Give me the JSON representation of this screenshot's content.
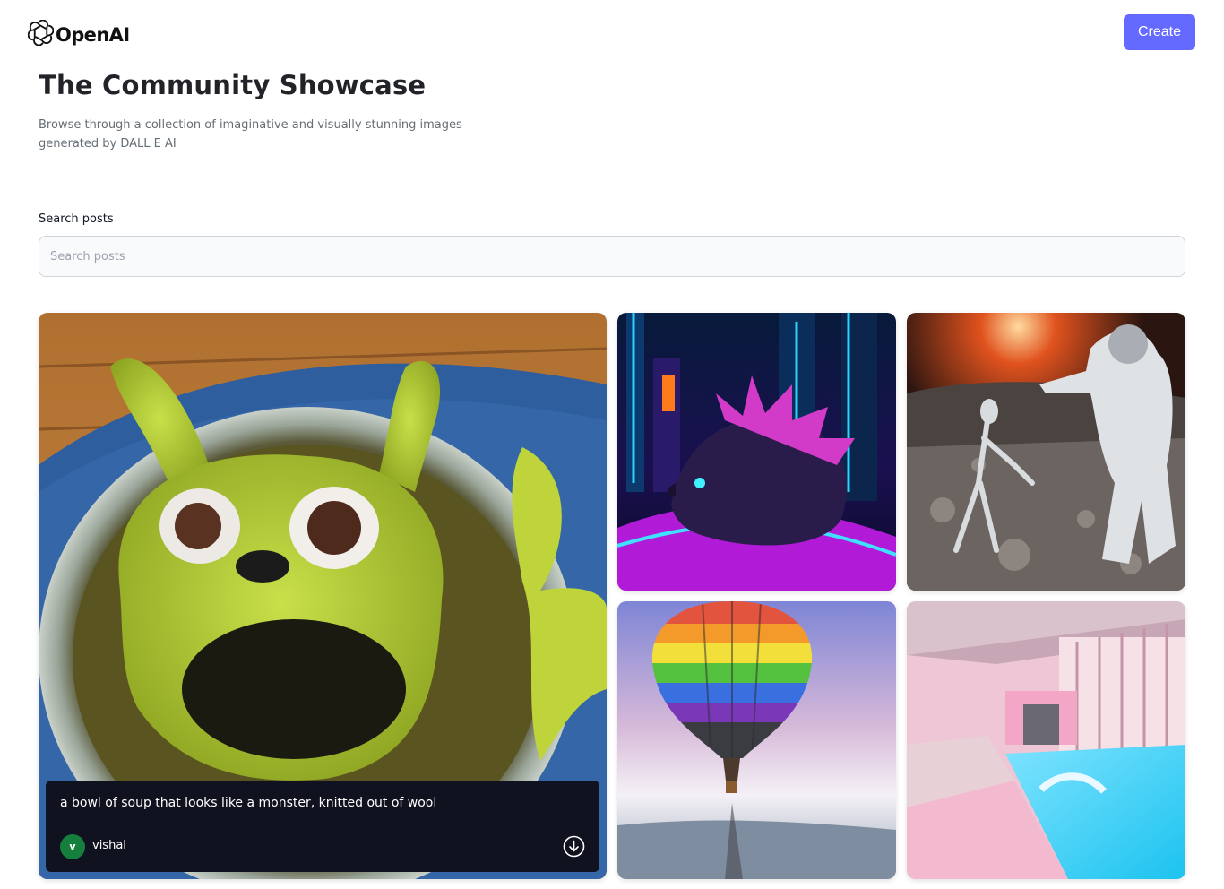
{
  "header": {
    "brand": "OpenAI",
    "create_label": "Create",
    "logo_icon": "openai-logo-icon"
  },
  "main": {
    "title": "The Community Showcase",
    "subtitle": "Browse through a collection of imaginative and visually stunning images generated by DALL E AI",
    "search_label": "Search posts",
    "search_placeholder": "Search posts"
  },
  "gallery": {
    "featured": {
      "prompt": "a bowl of soup that looks like a monster, knitted out of wool",
      "author": "vishal",
      "avatar_initial": "v",
      "download_icon": "download-icon"
    }
  },
  "colors": {
    "accent": "#6469ff",
    "caption_bg": "#10131f",
    "avatar_bg": "#15803d"
  }
}
